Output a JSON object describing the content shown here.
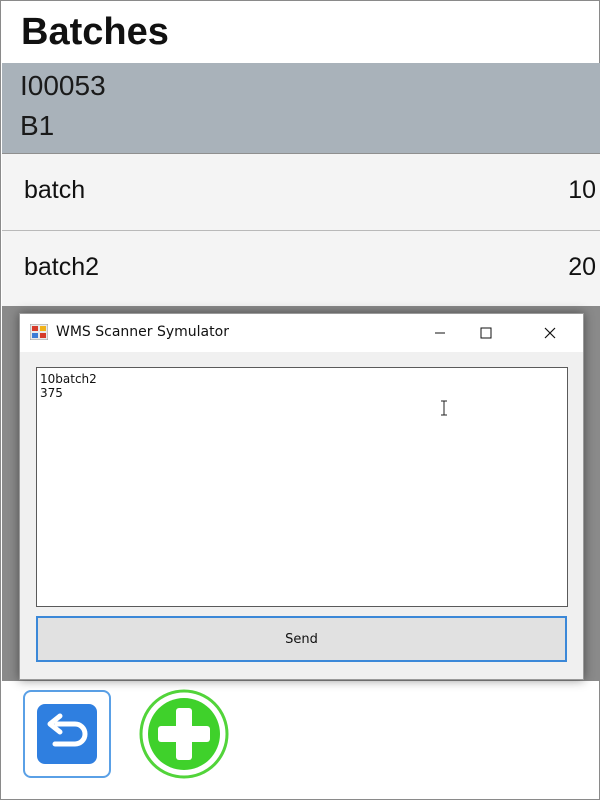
{
  "page": {
    "title": "Batches"
  },
  "header": {
    "line1": "I00053",
    "line2": "B1"
  },
  "batches": [
    {
      "name": "batch",
      "qty": "10"
    },
    {
      "name": "batch2",
      "qty": "20"
    }
  ],
  "dialog": {
    "title": "WMS Scanner Symulator",
    "text_value": "10batch2\n375",
    "send_label": "Send"
  },
  "icons": {
    "back": "undo-arrow-icon",
    "add": "plus-circle-icon",
    "app": "scanner-app-icon"
  },
  "colors": {
    "header_band": "#a9b2ba",
    "back_button": "#2f7fe0",
    "add_button": "#3fd12b",
    "focus_border": "#3b88d8"
  }
}
